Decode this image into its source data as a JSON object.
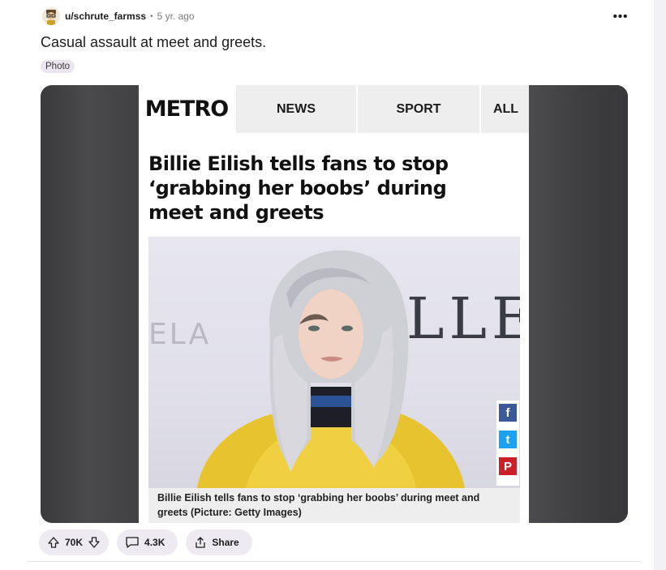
{
  "post": {
    "username": "u/schrute_farmss",
    "separator": "•",
    "age": "5 yr. ago",
    "more": "•••",
    "title": "Casual assault at meet and greets.",
    "flair": "Photo"
  },
  "article": {
    "logo": "METRO",
    "nav": [
      "NEWS",
      "SPORT",
      "ALL"
    ],
    "headline": "Billie Eilish tells fans to stop ‘grabbing her boobs’ during meet and greets",
    "backdrop_text": "LLE",
    "backdrop_small": "ELA",
    "share_icons": [
      "facebook-icon",
      "twitter-icon",
      "pinterest-icon"
    ],
    "share_glyphs": [
      "f",
      "t",
      "P"
    ],
    "caption": "Billie Eilish tells fans to stop ‘grabbing her boobs’ during meet and greets (Picture: Getty Images)"
  },
  "actions": {
    "votes": "70K",
    "comments": "4.3K",
    "share": "Share"
  },
  "colors": {
    "facebook": "#3b5998",
    "twitter": "#1da1f2",
    "pinterest": "#cb2027",
    "pill_bg": "#edeaf1"
  }
}
